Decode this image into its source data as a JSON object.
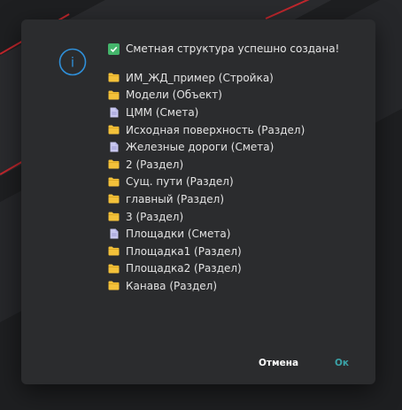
{
  "dialog": {
    "header": {
      "icon": "check-icon",
      "text": "Сметная структура успешно создана!"
    },
    "info_icon_letter": "i",
    "items": [
      {
        "icon": "folder-icon",
        "label": "ИМ_ЖД_пример (Стройка)"
      },
      {
        "icon": "folder-icon",
        "label": "Модели (Объект)"
      },
      {
        "icon": "document-icon",
        "label": "ЦММ (Смета)"
      },
      {
        "icon": "folder-icon",
        "label": "Исходная поверхность (Раздел)"
      },
      {
        "icon": "document-icon",
        "label": "Железные дороги (Смета)"
      },
      {
        "icon": "folder-icon",
        "label": "2 (Раздел)"
      },
      {
        "icon": "folder-icon",
        "label": "Сущ. пути (Раздел)"
      },
      {
        "icon": "folder-icon",
        "label": "главный (Раздел)"
      },
      {
        "icon": "folder-icon",
        "label": "3 (Раздел)"
      },
      {
        "icon": "document-icon",
        "label": "Площадки (Смета)"
      },
      {
        "icon": "folder-icon",
        "label": "Площадка1 (Раздел)"
      },
      {
        "icon": "folder-icon",
        "label": "Площадка2 (Раздел)"
      },
      {
        "icon": "folder-icon",
        "label": "Канава (Раздел)"
      }
    ],
    "buttons": {
      "cancel": "Отмена",
      "ok": "Ок"
    }
  },
  "colors": {
    "background": "#1e1f21",
    "dialog": "#2b2c2e",
    "accent_info": "#2f8fd8",
    "success": "#44b56b",
    "folder": "#f3c13a",
    "document": "#c9c8f0",
    "ok_button": "#3aa3a8"
  }
}
